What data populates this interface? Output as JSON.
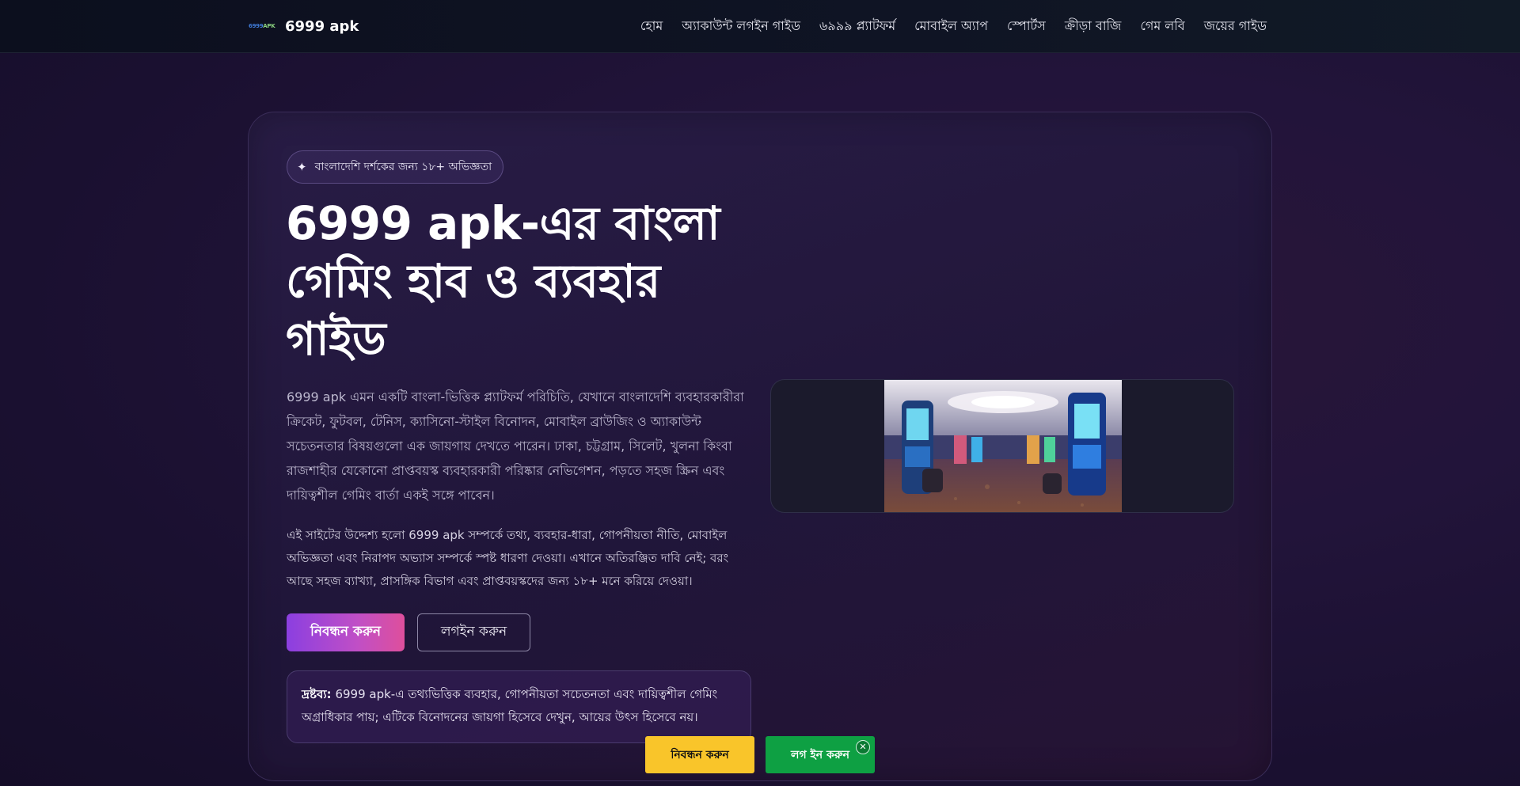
{
  "header": {
    "brand_logo_text": "6999APK",
    "brand_name": "6999 apk",
    "nav": [
      {
        "label": "হোম"
      },
      {
        "label": "অ্যাকাউন্ট লগইন গাইড"
      },
      {
        "label": "৬৯৯৯ প্ল্যাটফর্ম"
      },
      {
        "label": "মোবাইল অ্যাপ"
      },
      {
        "label": "স্পোর্টস"
      },
      {
        "label": "ক্রীড়া বাজি"
      },
      {
        "label": "গেম লবি"
      },
      {
        "label": "জয়ের গাইড"
      }
    ]
  },
  "hero": {
    "badge": {
      "icon": "sparkle-icon",
      "text": "বাংলাদেশি দর্শকের জন্য ১৮+ অভিজ্ঞতা"
    },
    "title": "6999 apk-এর বাংলা গেমিং হাব ও ব্যবহার গাইড",
    "paragraph_1": "6999 apk এমন একটি বাংলা-ভিত্তিক প্ল্যাটফর্ম পরিচিতি, যেখানে বাংলাদেশি ব্যবহারকারীরা ক্রিকেট, ফুটবল, টেনিস, ক্যাসিনো-স্টাইল বিনোদন, মোবাইল ব্রাউজিং ও অ্যাকাউন্ট সচেতনতার বিষয়গুলো এক জায়গায় দেখতে পারেন। ঢাকা, চট্টগ্রাম, সিলেট, খুলনা কিংবা রাজশাহীর যেকোনো প্রাপ্তবয়স্ক ব্যবহারকারী পরিষ্কার নেভিগেশন, পড়তে সহজ স্ক্রিন এবং দায়িত্বশীল গেমিং বার্তা একই সঙ্গে পাবেন।",
    "paragraph_2": "এই সাইটের উদ্দেশ্য হলো 6999 apk সম্পর্কে তথ্য, ব্যবহার-ধারা, গোপনীয়তা নীতি, মোবাইল অভিজ্ঞতা এবং নিরাপদ অভ্যাস সম্পর্কে স্পষ্ট ধারণা দেওয়া। এখানে অতিরঞ্জিত দাবি নেই; বরং আছে সহজ ব্যাখ্যা, প্রাসঙ্গিক বিভাগ এবং প্রাপ্তবয়স্কদের জন্য ১৮+ মনে করিয়ে দেওয়া।",
    "register_label": "নিবন্ধন করুন",
    "login_label": "লগইন করুন",
    "note_label": "দ্রষ্টব্য:",
    "note_text": " 6999 apk-এ তথ্যভিত্তিক ব্যবহার, গোপনীয়তা সচেতনতা এবং দায়িত্বশীল গেমিং অগ্রাধিকার পায়; এটিকে বিনোদনের জায়গা হিসেবে দেখুন, আয়ের উৎস হিসেবে নয়।"
  },
  "sticky": {
    "register_label": "নিবন্ধন করুন",
    "login_label": "লগ ইন করুন",
    "close_glyph": "✕"
  }
}
